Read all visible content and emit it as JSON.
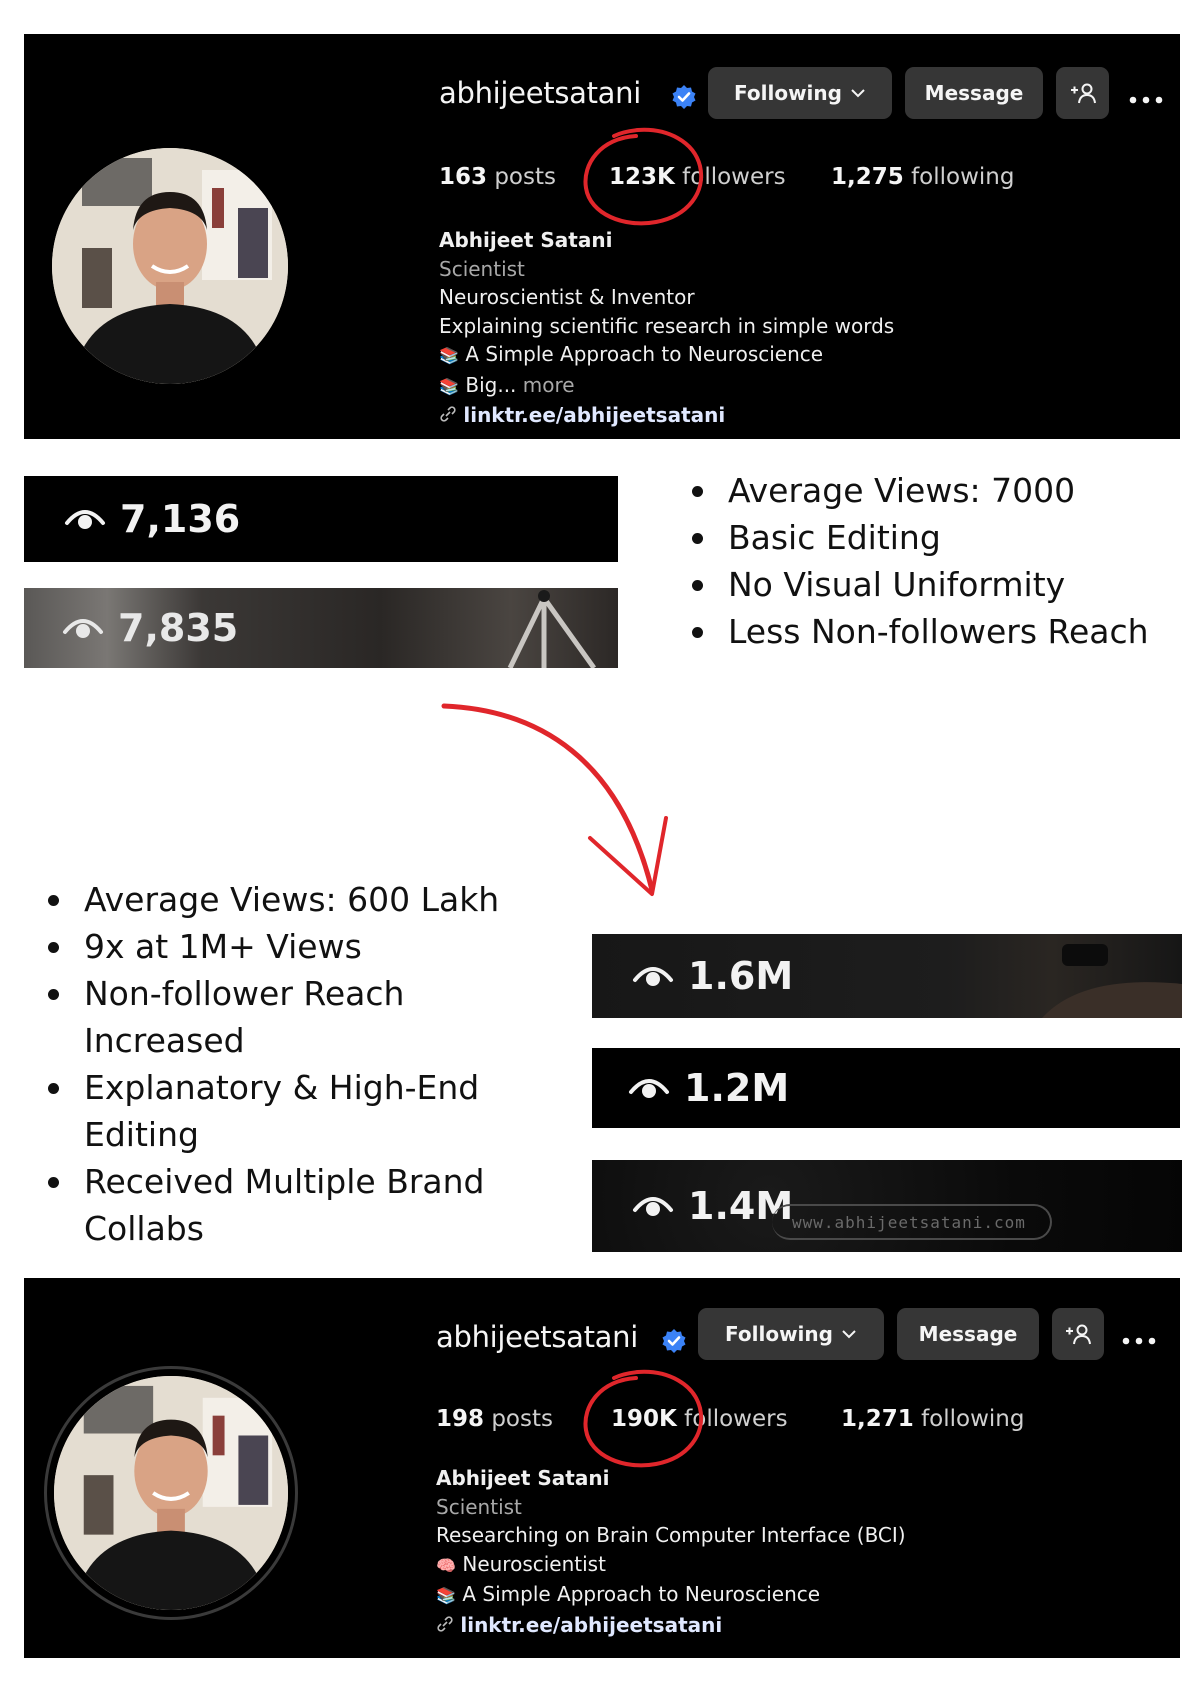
{
  "profile_before": {
    "username": "abhijeetsatani",
    "following_button": "Following",
    "message_button": "Message",
    "posts_count": "163",
    "posts_label": "posts",
    "followers_count": "123K",
    "followers_label": "followers",
    "following_count": "1,275",
    "following_label": "following",
    "display_name": "Abhijeet Satani",
    "category": "Scientist",
    "bio_lines": [
      "Neuroscientist & Inventor",
      "Explaining scientific research in simple words",
      "A Simple Approach to Neuroscience",
      "Big..."
    ],
    "more_label": "more",
    "link": "linktr.ee/abhijeetsatani"
  },
  "views_before": [
    "7,136",
    "7,835"
  ],
  "bullets_before": [
    "Average Views: 7000",
    "Basic Editing",
    "No Visual Uniformity",
    "Less Non-followers Reach"
  ],
  "bullets_after": [
    "Average Views: 600 Lakh",
    "9x at 1M+ Views",
    "Non-follower Reach Increased",
    "Explanatory & High-End Editing",
    "Received Multiple Brand Collabs"
  ],
  "views_after": [
    "1.6M",
    "1.2M",
    "1.4M"
  ],
  "watermark": "www.abhijeetsatani.com",
  "profile_after": {
    "username": "abhijeetsatani",
    "following_button": "Following",
    "message_button": "Message",
    "posts_count": "198",
    "posts_label": "posts",
    "followers_count": "190K",
    "followers_label": "followers",
    "following_count": "1,271",
    "following_label": "following",
    "display_name": "Abhijeet Satani",
    "category": "Scientist",
    "bio_lines": [
      "Researching on Brain Computer Interface (BCI)",
      "Neuroscientist",
      "A Simple Approach to Neuroscience"
    ],
    "link": "linktr.ee/abhijeetsatani"
  },
  "colors": {
    "annotation_red": "#e0262b",
    "verified_blue": "#3b82f6",
    "button_bg": "#363636"
  },
  "icons": [
    "verified-badge-icon",
    "chevron-down-icon",
    "add-person-icon",
    "more-dots-icon",
    "link-icon",
    "books-icon",
    "brain-icon",
    "eye-icon",
    "curved-arrow-icon"
  ]
}
